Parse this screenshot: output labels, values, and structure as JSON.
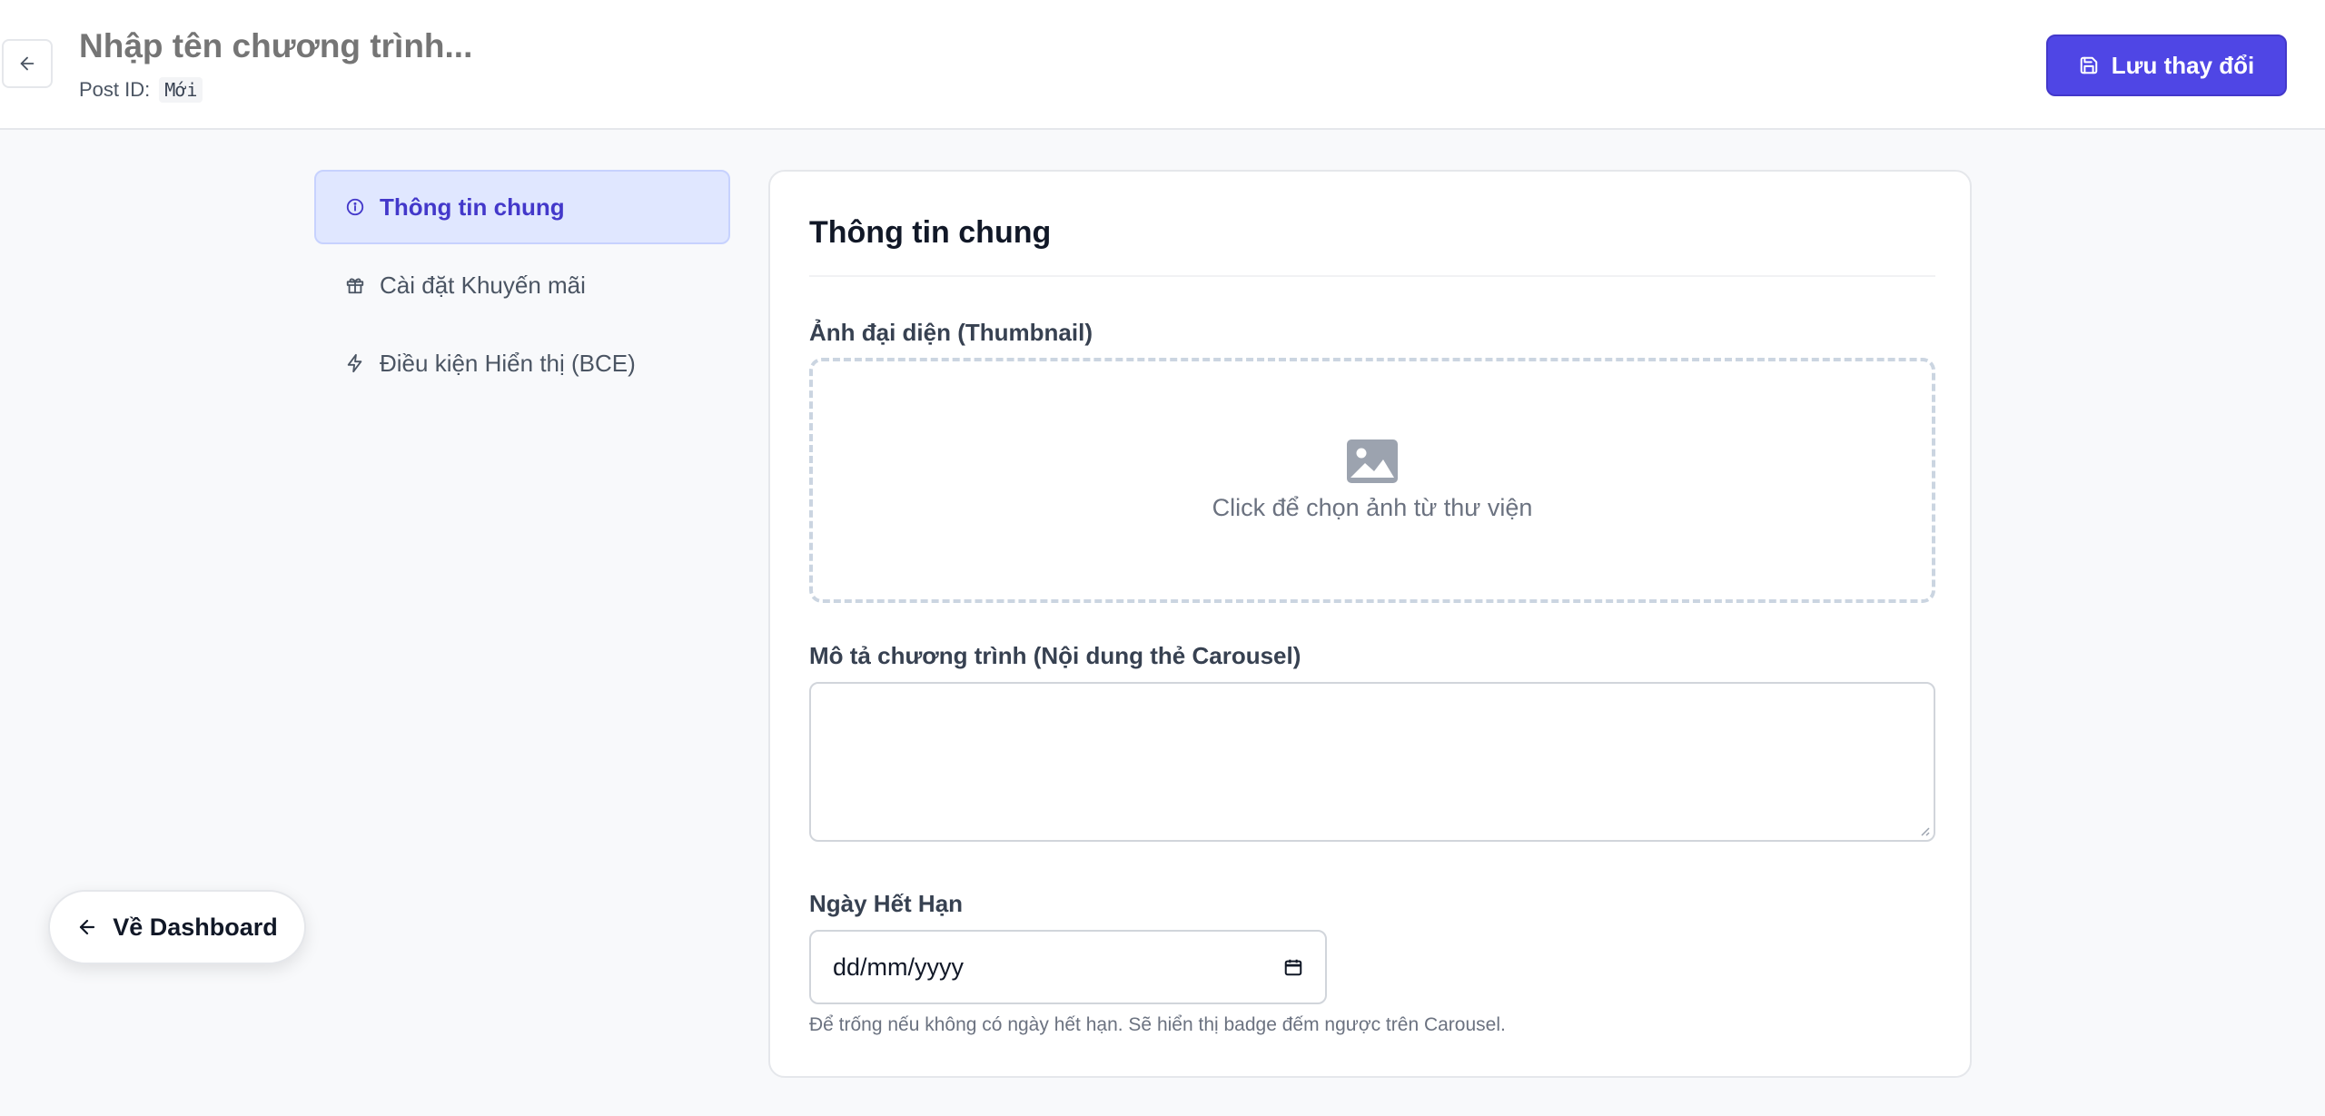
{
  "header": {
    "title_placeholder": "Nhập tên chương trình...",
    "postid_label": "Post ID:",
    "postid_value": "Mới",
    "save_label": "Lưu thay đổi"
  },
  "nav": {
    "items": [
      {
        "label": "Thông tin chung",
        "icon": "info-circle-icon",
        "active": true
      },
      {
        "label": "Cài đặt Khuyến mãi",
        "icon": "gift-icon",
        "active": false
      },
      {
        "label": "Điều kiện Hiển thị (BCE)",
        "icon": "lightning-icon",
        "active": false
      }
    ]
  },
  "card": {
    "title": "Thông tin chung",
    "thumbnail_label": "Ảnh đại diện (Thumbnail)",
    "upload_text": "Click để chọn ảnh từ thư viện",
    "description_label": "Mô tả chương trình (Nội dung thẻ Carousel)",
    "description_value": "",
    "expiry_label": "Ngày Hết Hạn",
    "expiry_placeholder": "dd/mm/yyyy",
    "expiry_hint": "Để trống nếu không có ngày hết hạn. Sẽ hiển thị badge đếm ngược trên Carousel."
  },
  "floating": {
    "dashboard_label": "Về Dashboard"
  },
  "colors": {
    "accent": "#4f46e5",
    "active_bg": "#e0e7ff",
    "active_text": "#4338ca"
  }
}
